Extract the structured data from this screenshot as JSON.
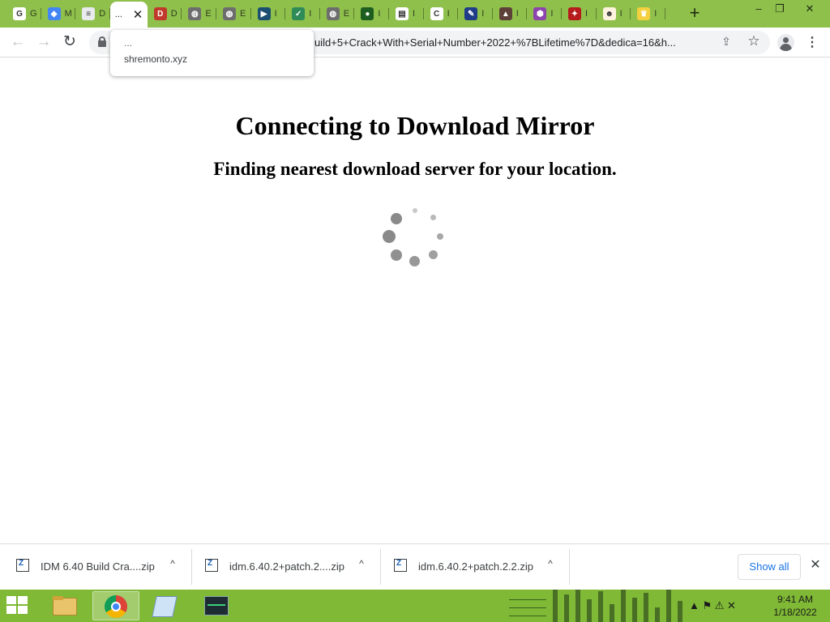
{
  "browser": {
    "tabs": [
      {
        "icon": "google-icon",
        "title": "G",
        "color": "#ffffff",
        "glyph": "G",
        "active": false
      },
      {
        "icon": "maps-icon",
        "title": "M",
        "color": "#4285f4",
        "glyph": "◆",
        "active": false
      },
      {
        "icon": "doc-icon",
        "title": "D",
        "color": "#e8eaed",
        "glyph": "≡",
        "active": false
      },
      {
        "icon": "loading-icon",
        "title": "...",
        "color": "#ffffff",
        "glyph": "",
        "active": true
      },
      {
        "icon": "site-icon",
        "title": "D",
        "color": "#c0392b",
        "glyph": "D",
        "active": false
      },
      {
        "icon": "globe-icon",
        "title": "E",
        "color": "#6d6d6d",
        "glyph": "◍",
        "active": false
      },
      {
        "icon": "globe-icon",
        "title": "E",
        "color": "#6d6d6d",
        "glyph": "◍",
        "active": false
      },
      {
        "icon": "arrow-icon",
        "title": "I",
        "color": "#1b4f72",
        "glyph": "▶",
        "active": false
      },
      {
        "icon": "check-icon",
        "title": "I",
        "color": "#2e8b57",
        "glyph": "✓",
        "active": false
      },
      {
        "icon": "globe-icon",
        "title": "E",
        "color": "#6d6d6d",
        "glyph": "◍",
        "active": false
      },
      {
        "icon": "planet-icon",
        "title": "I",
        "color": "#1d5e20",
        "glyph": "●",
        "active": false
      },
      {
        "icon": "document-icon",
        "title": "I",
        "color": "#ffffff",
        "glyph": "▤",
        "active": false
      },
      {
        "icon": "c-icon",
        "title": "I",
        "color": "#ffffff",
        "glyph": "C",
        "active": false
      },
      {
        "icon": "pen-icon",
        "title": "I",
        "color": "#1f3c88",
        "glyph": "✎",
        "active": false
      },
      {
        "icon": "castle-icon",
        "title": "I",
        "color": "#5d4037",
        "glyph": "▲",
        "active": false
      },
      {
        "icon": "package-icon",
        "title": "I",
        "color": "#8e44ad",
        "glyph": "⬢",
        "active": false
      },
      {
        "icon": "badge-icon",
        "title": "I",
        "color": "#b71c1c",
        "glyph": "✦",
        "active": false
      },
      {
        "icon": "person-icon",
        "title": "I",
        "color": "#fff3e0",
        "glyph": "☻",
        "active": false
      },
      {
        "icon": "crown-icon",
        "title": "I",
        "color": "#f4d03f",
        "glyph": "♛",
        "active": false
      }
    ],
    "new_tab": "+",
    "window_controls": {
      "minimize": "–",
      "restore": "❐",
      "close": "✕"
    },
    "nav": {
      "back": "←",
      "forward": "→",
      "reload": "↻"
    },
    "url": "uild+5+Crack+With+Serial+Number+2022+%7BLifetime%7D&dedica=16&h...",
    "share": "⇪",
    "star": "☆",
    "menu": "⋮",
    "tooltip": {
      "line1": "...",
      "line2": "shremonto.xyz"
    }
  },
  "page": {
    "heading": "Connecting to Download Mirror",
    "subheading": "Finding nearest download server for your location."
  },
  "downloads": {
    "items": [
      {
        "name": "IDM 6.40 Build  Cra....zip"
      },
      {
        "name": "idm.6.40.2+patch.2....zip"
      },
      {
        "name": "idm.6.40.2+patch.2.2.zip"
      }
    ],
    "chevron": "^",
    "show_all": "Show all",
    "close": "✕"
  },
  "taskbar": {
    "clock_time": "9:41 AM",
    "clock_date": "1/18/2022",
    "tray": "▲  ⚑  ⚠  ✕"
  }
}
